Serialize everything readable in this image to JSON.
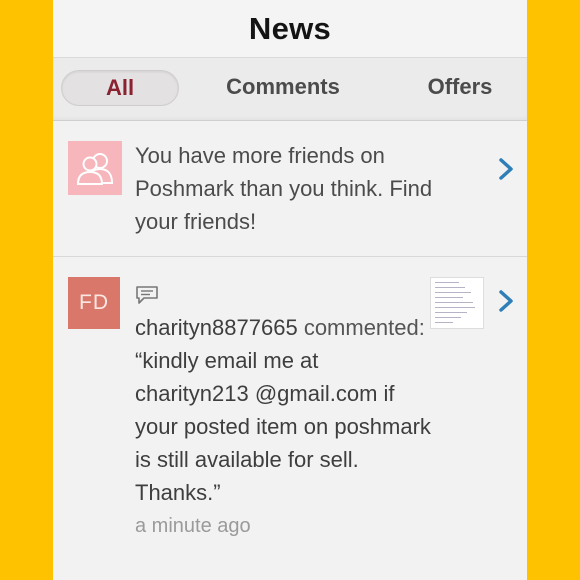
{
  "header": {
    "title": "News"
  },
  "tabs": [
    {
      "label": "All",
      "selected": true
    },
    {
      "label": "Comments",
      "selected": false
    },
    {
      "label": "Offers",
      "selected": false
    }
  ],
  "notifications": [
    {
      "icon": "friends-icon",
      "text": "You have more friends on Poshmark than you think. Find your friends!"
    },
    {
      "avatar_initials": "FD",
      "icon": "comment-bubble-icon",
      "username": "charityn8877665",
      "action": "commented:",
      "comment": "“kindly email me at charityn213 @gmail.com if your posted item on poshmark is still available for sell. Thanks.”",
      "timestamp": "a minute ago"
    }
  ],
  "colors": {
    "background": "#FFC200",
    "selected_tab_text": "#8A2232",
    "chevron": "#2E7FB8",
    "avatar_bg": "#D9786A",
    "friends_icon_bg": "#F6B6BC"
  }
}
